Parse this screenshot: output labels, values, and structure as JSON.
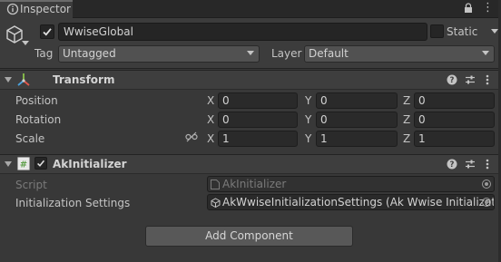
{
  "tab": {
    "title": "Inspector",
    "icon": "info-icon"
  },
  "toolbar": {
    "lock_icon": "lock-icon",
    "more_icon": "more-options-icon"
  },
  "gameobject": {
    "icon": "cube-icon",
    "active": true,
    "name": "WwiseGlobal",
    "static_label": "Static",
    "static": false,
    "tag_label": "Tag",
    "tag_value": "Untagged",
    "layer_label": "Layer",
    "layer_value": "Default"
  },
  "transform": {
    "title": "Transform",
    "expanded": true,
    "icon": "transform-axes-icon",
    "rows": [
      {
        "label": "Position",
        "x": "0",
        "y": "0",
        "z": "0"
      },
      {
        "label": "Rotation",
        "x": "0",
        "y": "0",
        "z": "0"
      },
      {
        "label": "Scale",
        "x": "1",
        "y": "1",
        "z": "1"
      }
    ],
    "axis_labels": {
      "x": "X",
      "y": "Y",
      "z": "Z"
    },
    "scale_link_icon": "link-broken-icon"
  },
  "ak_initializer": {
    "title": "AkInitializer",
    "expanded": true,
    "enabled": true,
    "icon": "csharp-script-icon",
    "script_label": "Script",
    "script_value": "AkInitializer",
    "settings_label": "Initialization Settings",
    "settings_value": "AkWwiseInitializationSettings (Ak Wwise Initializat"
  },
  "header_icons": [
    "help-icon",
    "preset-icon",
    "context-menu-icon"
  ],
  "add_component_label": "Add Component",
  "colors": {
    "background": "#383838",
    "tab_bar": "#282828",
    "field": "#2a2a2a",
    "button": "#585858",
    "checkmark": "#e0e0e0",
    "transform_icon_red": "#e2574c",
    "transform_icon_green": "#8bc34a",
    "transform_icon_blue": "#4aa3df",
    "script_icon_green": "#5c9e48"
  }
}
